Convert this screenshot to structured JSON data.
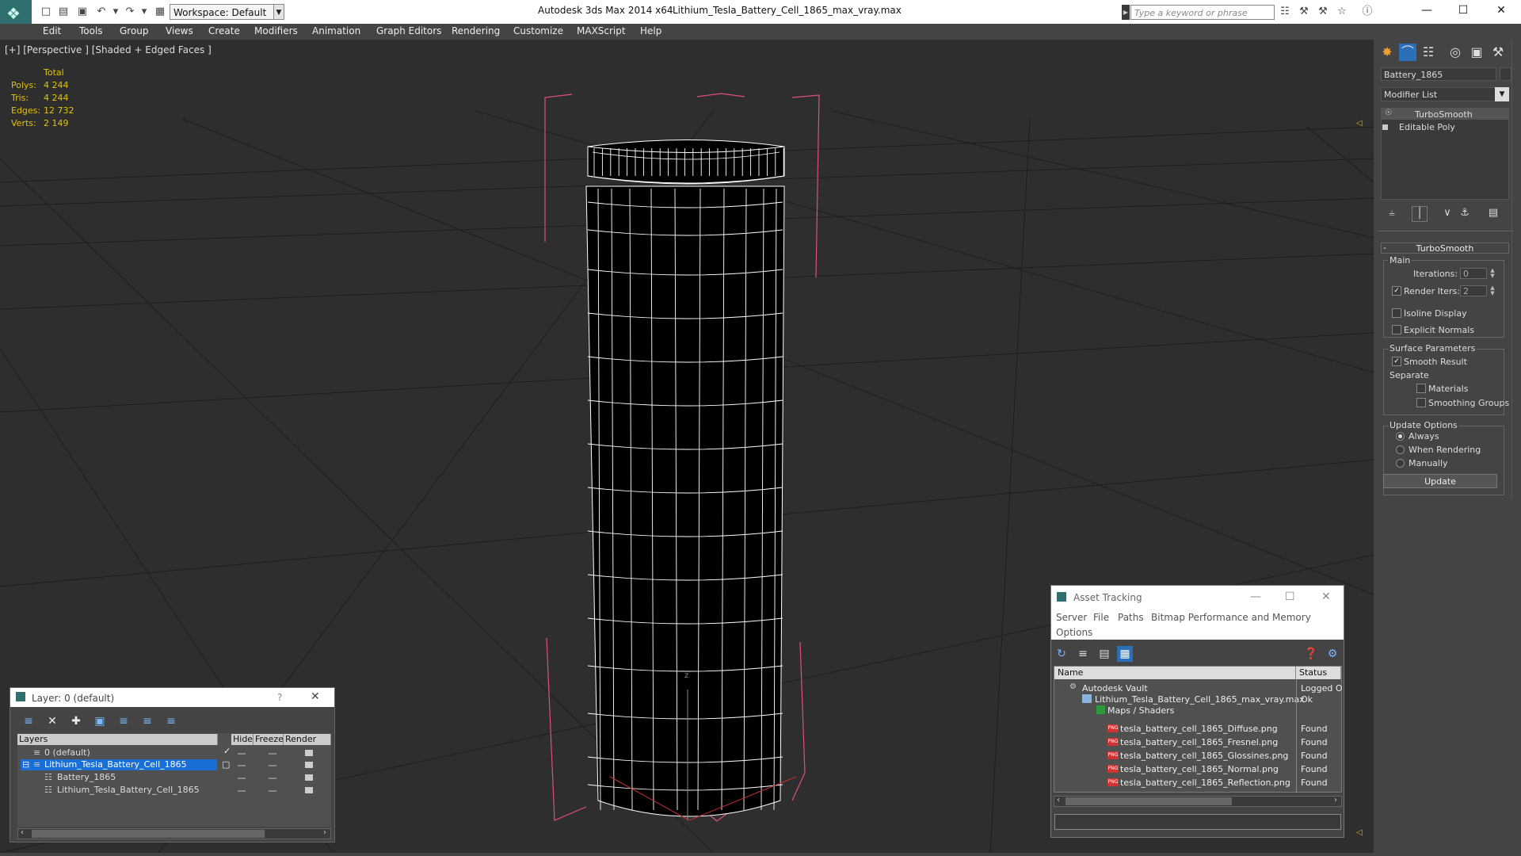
{
  "titlebar": {
    "app_title": "Autodesk 3ds Max  2014 x64",
    "file_title": "Lithium_Tesla_Battery_Cell_1865_max_vray.max",
    "workspace": "Workspace: Default",
    "search_placeholder": "Type a keyword or phrase",
    "minimize": "—",
    "maximize": "☐",
    "close": "✕"
  },
  "menubar": [
    "Edit",
    "Tools",
    "Group",
    "Views",
    "Create",
    "Modifiers",
    "Animation",
    "Graph Editors",
    "Rendering",
    "Customize",
    "MAXScript",
    "Help"
  ],
  "viewport": {
    "label": "[+] [Perspective ] [Shaded + Edged Faces ]",
    "stats": {
      "header": "Total",
      "rows": [
        {
          "label": "Polys:",
          "value": "4 244"
        },
        {
          "label": "Tris:",
          "value": "4 244"
        },
        {
          "label": "Edges:",
          "value": "12 732"
        },
        {
          "label": "Verts:",
          "value": "2 149"
        }
      ]
    },
    "axis_label": "z"
  },
  "command_panel": {
    "object_name": "Battery_1865",
    "modifier_list": "Modifier List",
    "stack": [
      "TurboSmooth",
      "Editable Poly"
    ],
    "rollout_title": "TurboSmooth",
    "rollout_collapse": "-",
    "main": {
      "group": "Main",
      "iterations_label": "Iterations:",
      "iterations_value": "0",
      "render_iters_label": "Render Iters:",
      "render_iters_value": "2",
      "isoline_label": "Isoline Display",
      "explicit_label": "Explicit Normals"
    },
    "surface": {
      "group": "Surface Parameters",
      "smooth_result": "Smooth Result",
      "separate": "Separate",
      "materials": "Materials",
      "smoothing_groups": "Smoothing Groups"
    },
    "update": {
      "group": "Update Options",
      "always": "Always",
      "when_rendering": "When Rendering",
      "manually": "Manually",
      "button": "Update"
    }
  },
  "layer_window": {
    "title": "Layer: 0 (default)",
    "help": "?",
    "close": "✕",
    "columns": [
      "Layers",
      "Hide",
      "Freeze",
      "Render"
    ],
    "rows": [
      {
        "name": "0 (default)"
      },
      {
        "name": "Lithium_Tesla_Battery_Cell_1865"
      },
      {
        "name": "Battery_1865"
      },
      {
        "name": "Lithium_Tesla_Battery_Cell_1865"
      }
    ]
  },
  "asset_tracking": {
    "title": "Asset Tracking",
    "menu": [
      "Server",
      "File",
      "Paths",
      "Bitmap Performance and Memory",
      "Options"
    ],
    "columns": [
      "Name",
      "Status"
    ],
    "rows": [
      {
        "name": "Autodesk Vault",
        "status": "Logged O"
      },
      {
        "name": "Lithium_Tesla_Battery_Cell_1865_max_vray.max",
        "status": "Ok"
      },
      {
        "name": "Maps / Shaders",
        "status": ""
      },
      {
        "name": "tesla_battery_cell_1865_Diffuse.png",
        "status": "Found"
      },
      {
        "name": "tesla_battery_cell_1865_Fresnel.png",
        "status": "Found"
      },
      {
        "name": "tesla_battery_cell_1865_Glossines.png",
        "status": "Found"
      },
      {
        "name": "tesla_battery_cell_1865_Normal.png",
        "status": "Found"
      },
      {
        "name": "tesla_battery_cell_1865_Reflection.png",
        "status": "Found"
      }
    ],
    "png_badge": "PNG"
  },
  "colors": {
    "selection_blue": "#1a6fd6",
    "stats_yellow": "#e6c200",
    "bbox_pink": "#e0507a",
    "wire_white": "#ffffff"
  }
}
